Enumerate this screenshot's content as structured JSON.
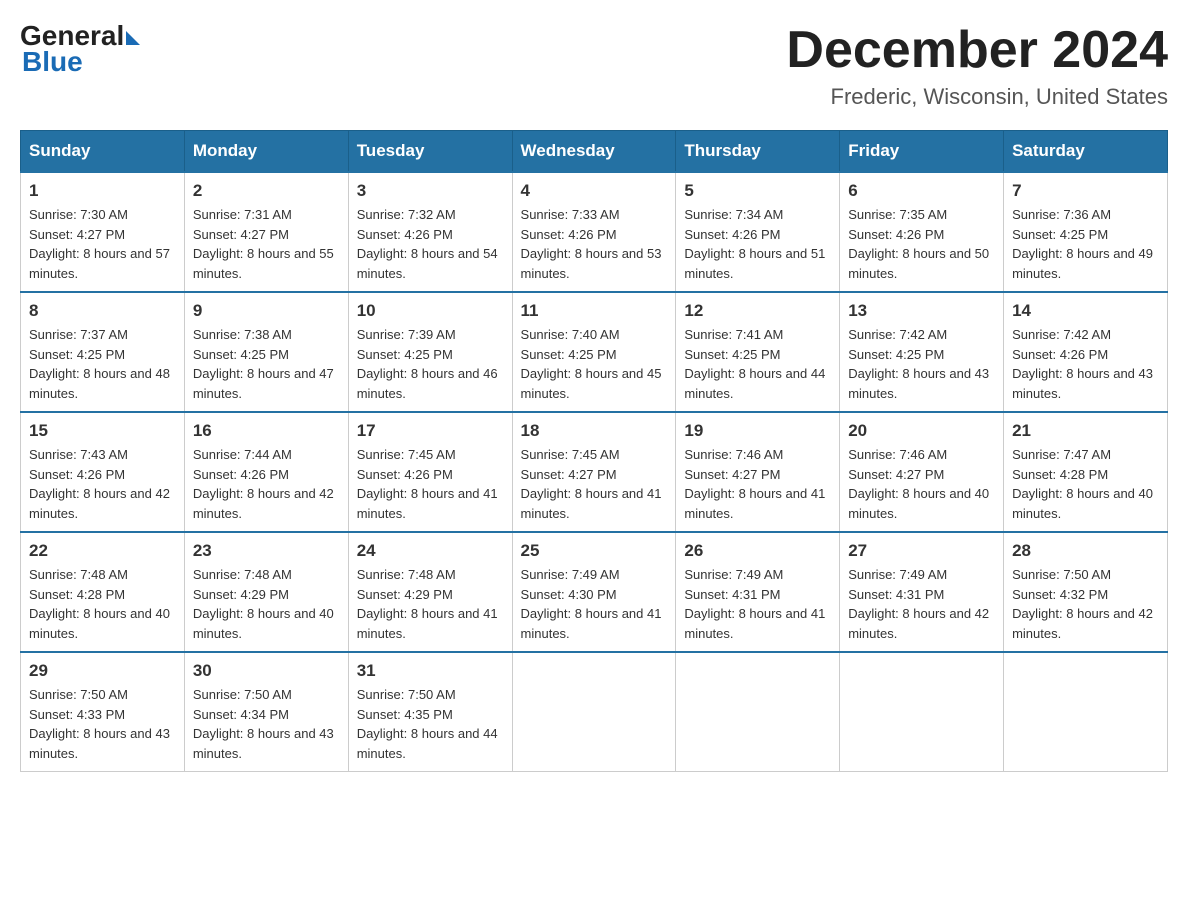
{
  "logo": {
    "general": "General",
    "blue": "Blue"
  },
  "title": "December 2024",
  "location": "Frederic, Wisconsin, United States",
  "days_of_week": [
    "Sunday",
    "Monday",
    "Tuesday",
    "Wednesday",
    "Thursday",
    "Friday",
    "Saturday"
  ],
  "weeks": [
    [
      {
        "day": "1",
        "sunrise": "7:30 AM",
        "sunset": "4:27 PM",
        "daylight": "8 hours and 57 minutes."
      },
      {
        "day": "2",
        "sunrise": "7:31 AM",
        "sunset": "4:27 PM",
        "daylight": "8 hours and 55 minutes."
      },
      {
        "day": "3",
        "sunrise": "7:32 AM",
        "sunset": "4:26 PM",
        "daylight": "8 hours and 54 minutes."
      },
      {
        "day": "4",
        "sunrise": "7:33 AM",
        "sunset": "4:26 PM",
        "daylight": "8 hours and 53 minutes."
      },
      {
        "day": "5",
        "sunrise": "7:34 AM",
        "sunset": "4:26 PM",
        "daylight": "8 hours and 51 minutes."
      },
      {
        "day": "6",
        "sunrise": "7:35 AM",
        "sunset": "4:26 PM",
        "daylight": "8 hours and 50 minutes."
      },
      {
        "day": "7",
        "sunrise": "7:36 AM",
        "sunset": "4:25 PM",
        "daylight": "8 hours and 49 minutes."
      }
    ],
    [
      {
        "day": "8",
        "sunrise": "7:37 AM",
        "sunset": "4:25 PM",
        "daylight": "8 hours and 48 minutes."
      },
      {
        "day": "9",
        "sunrise": "7:38 AM",
        "sunset": "4:25 PM",
        "daylight": "8 hours and 47 minutes."
      },
      {
        "day": "10",
        "sunrise": "7:39 AM",
        "sunset": "4:25 PM",
        "daylight": "8 hours and 46 minutes."
      },
      {
        "day": "11",
        "sunrise": "7:40 AM",
        "sunset": "4:25 PM",
        "daylight": "8 hours and 45 minutes."
      },
      {
        "day": "12",
        "sunrise": "7:41 AM",
        "sunset": "4:25 PM",
        "daylight": "8 hours and 44 minutes."
      },
      {
        "day": "13",
        "sunrise": "7:42 AM",
        "sunset": "4:25 PM",
        "daylight": "8 hours and 43 minutes."
      },
      {
        "day": "14",
        "sunrise": "7:42 AM",
        "sunset": "4:26 PM",
        "daylight": "8 hours and 43 minutes."
      }
    ],
    [
      {
        "day": "15",
        "sunrise": "7:43 AM",
        "sunset": "4:26 PM",
        "daylight": "8 hours and 42 minutes."
      },
      {
        "day": "16",
        "sunrise": "7:44 AM",
        "sunset": "4:26 PM",
        "daylight": "8 hours and 42 minutes."
      },
      {
        "day": "17",
        "sunrise": "7:45 AM",
        "sunset": "4:26 PM",
        "daylight": "8 hours and 41 minutes."
      },
      {
        "day": "18",
        "sunrise": "7:45 AM",
        "sunset": "4:27 PM",
        "daylight": "8 hours and 41 minutes."
      },
      {
        "day": "19",
        "sunrise": "7:46 AM",
        "sunset": "4:27 PM",
        "daylight": "8 hours and 41 minutes."
      },
      {
        "day": "20",
        "sunrise": "7:46 AM",
        "sunset": "4:27 PM",
        "daylight": "8 hours and 40 minutes."
      },
      {
        "day": "21",
        "sunrise": "7:47 AM",
        "sunset": "4:28 PM",
        "daylight": "8 hours and 40 minutes."
      }
    ],
    [
      {
        "day": "22",
        "sunrise": "7:48 AM",
        "sunset": "4:28 PM",
        "daylight": "8 hours and 40 minutes."
      },
      {
        "day": "23",
        "sunrise": "7:48 AM",
        "sunset": "4:29 PM",
        "daylight": "8 hours and 40 minutes."
      },
      {
        "day": "24",
        "sunrise": "7:48 AM",
        "sunset": "4:29 PM",
        "daylight": "8 hours and 41 minutes."
      },
      {
        "day": "25",
        "sunrise": "7:49 AM",
        "sunset": "4:30 PM",
        "daylight": "8 hours and 41 minutes."
      },
      {
        "day": "26",
        "sunrise": "7:49 AM",
        "sunset": "4:31 PM",
        "daylight": "8 hours and 41 minutes."
      },
      {
        "day": "27",
        "sunrise": "7:49 AM",
        "sunset": "4:31 PM",
        "daylight": "8 hours and 42 minutes."
      },
      {
        "day": "28",
        "sunrise": "7:50 AM",
        "sunset": "4:32 PM",
        "daylight": "8 hours and 42 minutes."
      }
    ],
    [
      {
        "day": "29",
        "sunrise": "7:50 AM",
        "sunset": "4:33 PM",
        "daylight": "8 hours and 43 minutes."
      },
      {
        "day": "30",
        "sunrise": "7:50 AM",
        "sunset": "4:34 PM",
        "daylight": "8 hours and 43 minutes."
      },
      {
        "day": "31",
        "sunrise": "7:50 AM",
        "sunset": "4:35 PM",
        "daylight": "8 hours and 44 minutes."
      },
      null,
      null,
      null,
      null
    ]
  ],
  "labels": {
    "sunrise": "Sunrise:",
    "sunset": "Sunset:",
    "daylight": "Daylight:"
  }
}
